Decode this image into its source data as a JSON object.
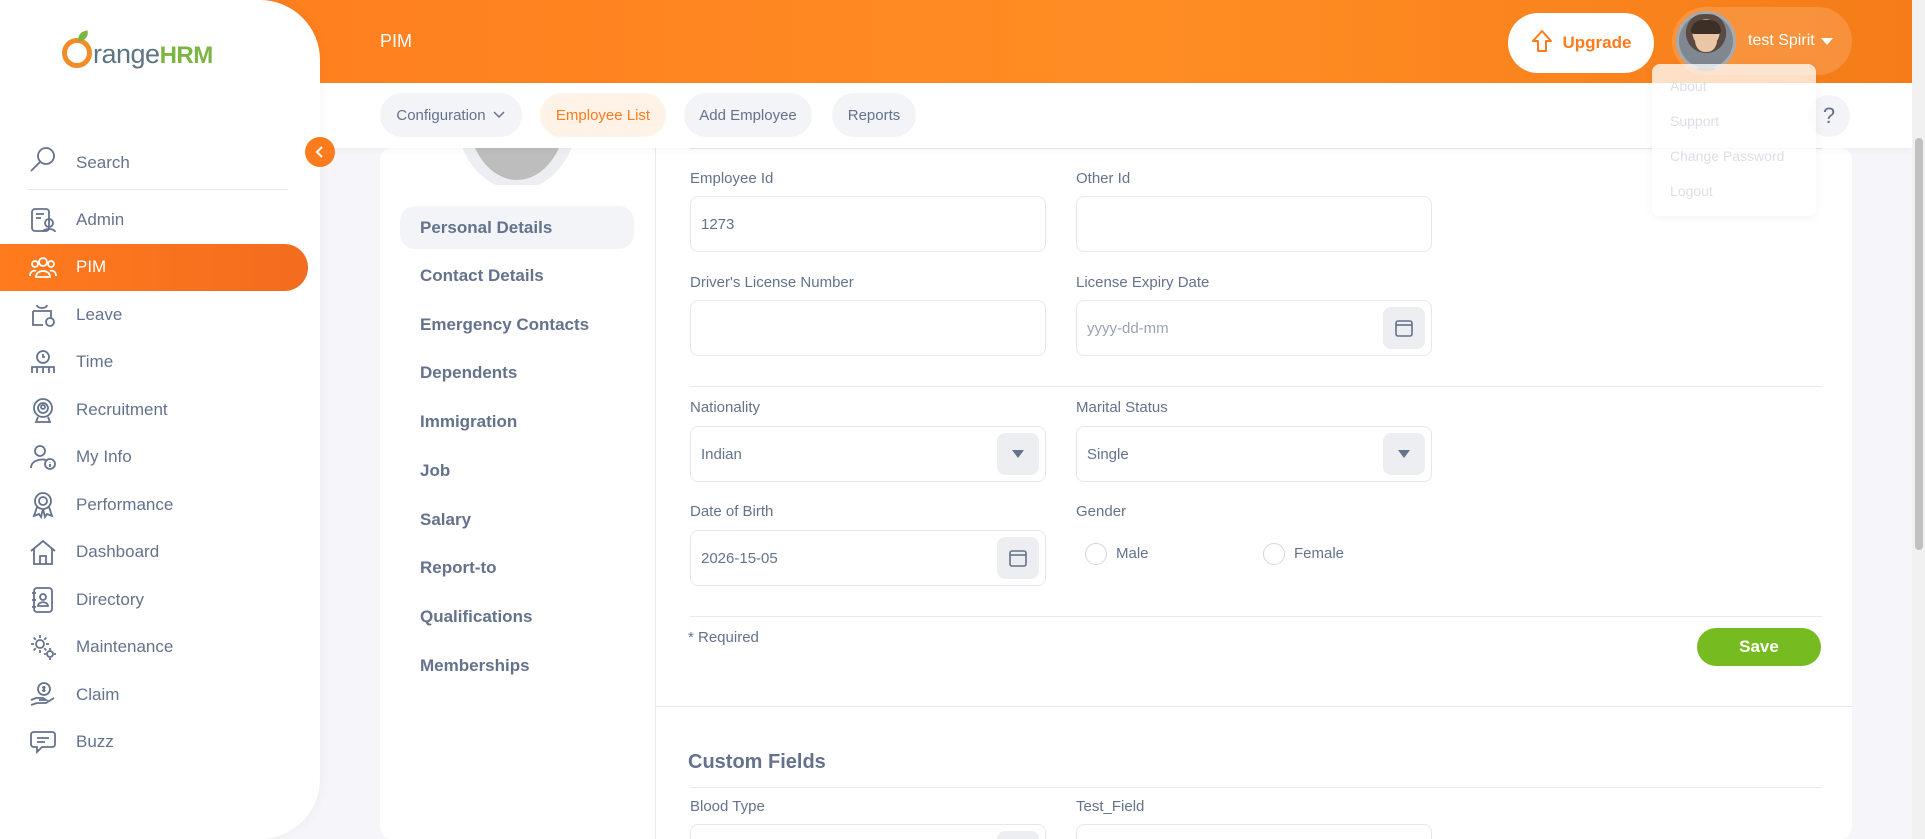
{
  "app": {
    "brand_main": "range",
    "brand_suffix": "HRM"
  },
  "header": {
    "module_title": "PIM",
    "upgrade_label": "Upgrade",
    "user_name": "test Spirit"
  },
  "user_menu": [
    "About",
    "Support",
    "Change Password",
    "Logout"
  ],
  "subnav": {
    "tabs": [
      "Configuration",
      "Employee List",
      "Add Employee",
      "Reports"
    ],
    "active": "Employee List",
    "help": "?"
  },
  "sidebar": {
    "search_label": "Search",
    "items": [
      {
        "label": "Admin",
        "icon": "admin-icon"
      },
      {
        "label": "PIM",
        "icon": "pim-icon",
        "active": true
      },
      {
        "label": "Leave",
        "icon": "leave-icon"
      },
      {
        "label": "Time",
        "icon": "time-icon"
      },
      {
        "label": "Recruitment",
        "icon": "recruitment-icon"
      },
      {
        "label": "My Info",
        "icon": "my-info-icon"
      },
      {
        "label": "Performance",
        "icon": "performance-icon"
      },
      {
        "label": "Dashboard",
        "icon": "dashboard-icon"
      },
      {
        "label": "Directory",
        "icon": "directory-icon"
      },
      {
        "label": "Maintenance",
        "icon": "maintenance-icon"
      },
      {
        "label": "Claim",
        "icon": "claim-icon"
      },
      {
        "label": "Buzz",
        "icon": "buzz-icon"
      }
    ]
  },
  "employee_nav": [
    "Personal Details",
    "Contact Details",
    "Emergency Contacts",
    "Dependents",
    "Immigration",
    "Job",
    "Salary",
    "Report-to",
    "Qualifications",
    "Memberships"
  ],
  "form": {
    "employee_id_label": "Employee Id",
    "employee_id_value": "1273",
    "other_id_label": "Other Id",
    "other_id_value": "",
    "license_label": "Driver's License Number",
    "license_value": "",
    "license_expiry_label": "License Expiry Date",
    "license_expiry_placeholder": "yyyy-dd-mm",
    "nationality_label": "Nationality",
    "nationality_value": "Indian",
    "marital_label": "Marital Status",
    "marital_value": "Single",
    "dob_label": "Date of Birth",
    "dob_value": "2026-15-05",
    "gender_label": "Gender",
    "gender_male": "Male",
    "gender_female": "Female",
    "required_note": "* Required",
    "save_label": "Save"
  },
  "custom_fields": {
    "title": "Custom Fields",
    "blood_type_label": "Blood Type",
    "test_field_label": "Test_Field"
  },
  "colors": {
    "accent": "#ff7b1d",
    "save": "#76bc21",
    "text": "#64728c"
  }
}
